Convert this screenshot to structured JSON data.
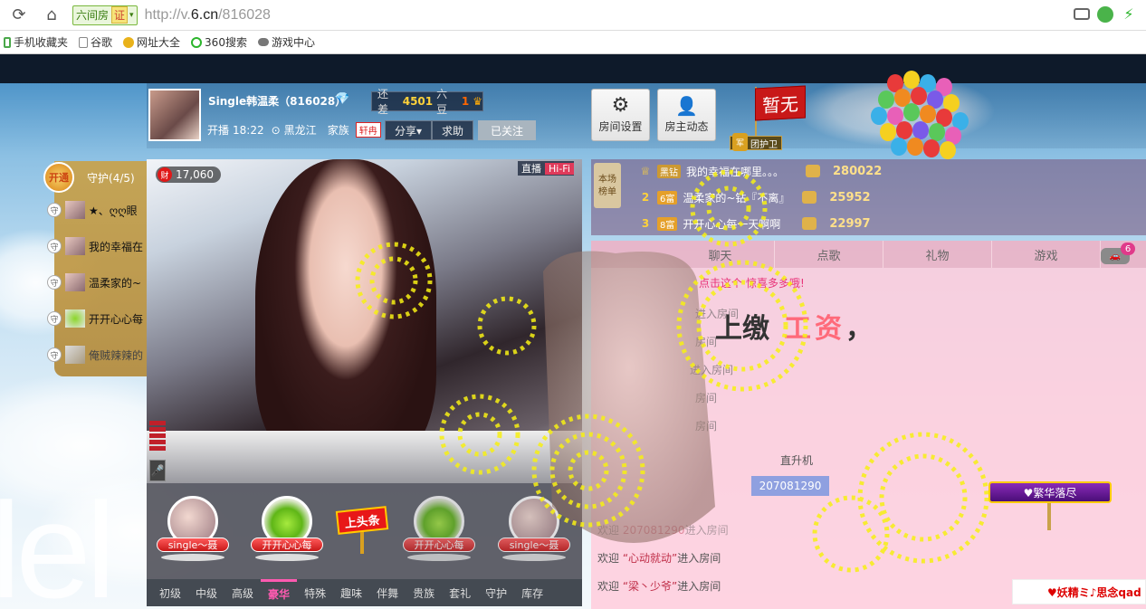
{
  "browser": {
    "site_badge": "六间房",
    "cert_badge": "证",
    "url_prefix": "http://v.",
    "url_domain": "6.cn",
    "url_path": "/816028"
  },
  "bookmarks": [
    {
      "label": "手机收藏夹",
      "icon": "phone-icon"
    },
    {
      "label": "谷歌",
      "icon": "page-icon"
    },
    {
      "label": "网址大全",
      "icon": "globe-icon"
    },
    {
      "label": "360搜索",
      "icon": "search-360-icon"
    },
    {
      "label": "游戏中心",
      "icon": "gamepad-icon"
    }
  ],
  "anchor": {
    "name": "Single韩温柔（816028）",
    "gap_label": "还差",
    "gap_amount": "4501",
    "gap_unit": "六豆",
    "level": "1",
    "start_label": "开播",
    "start_time": "18:22",
    "location": "黑龙江",
    "family_label": "家族",
    "family_tag": "轩冉"
  },
  "header_buttons": {
    "share": "分享▾",
    "help": "求助",
    "followed": "已关注",
    "room_settings": "房间设置",
    "host_feed": "房主动态",
    "badge_none": "暂无",
    "guard_tag": "团护卫",
    "guard_shield": "军"
  },
  "guard": {
    "open": "开通",
    "title_prefix": "守护(",
    "count": "4",
    "total": "5",
    "items": [
      {
        "tag": "守",
        "name": "★、ღღ眼"
      },
      {
        "tag": "守",
        "name": "我的幸福在"
      },
      {
        "tag": "守",
        "name": "温柔家的~"
      },
      {
        "tag": "守",
        "name": "开开心心每"
      },
      {
        "tag": "守",
        "name": "俺贼辣辣的"
      }
    ]
  },
  "video": {
    "viewer_coin": "财",
    "viewer_count": "17,060",
    "live": "直播",
    "hifi": "Hi-Fi",
    "mic": "🎤"
  },
  "gifts": {
    "headline": "上头条",
    "items": [
      "single～聂",
      "开开心心每",
      "开开心心每",
      "single～聂"
    ],
    "tabs": [
      "初级",
      "中级",
      "高级",
      "豪华",
      "特殊",
      "趣味",
      "伴舞",
      "贵族",
      "套礼",
      "守护",
      "库存"
    ],
    "active_tab": "豪华"
  },
  "ranking": {
    "badge_line1": "本场",
    "badge_line2": "榜单",
    "rows": [
      {
        "no": "1",
        "vip": "黑钻",
        "name": "我的幸福在哪里。。。",
        "amount": "280022"
      },
      {
        "no": "2",
        "vip": "6富",
        "name": "温柔家的~钻『不离』",
        "amount": "25952"
      },
      {
        "no": "3",
        "vip": "8富",
        "name": "开开心心每一天啊啊",
        "amount": "22997"
      }
    ]
  },
  "chat": {
    "tabs": [
      "聊天",
      "点歌",
      "礼物",
      "游戏"
    ],
    "car_count": "6",
    "hint_prefix": "点击这个",
    "hint_link": "惊喜多多哦!",
    "banner_a": "上缴",
    "banner_b": "工资",
    "banner_c": "，",
    "faded_lines": [
      "进入房间",
      "房间",
      "进入房间",
      "房间",
      "房间"
    ],
    "heli": "直升机",
    "uid": "207081290",
    "welcome_prefix": "欢迎",
    "welcome_suffix": "进入房间",
    "lines": [
      {
        "user": "207081290",
        "faded": true
      },
      {
        "user": "“心动就动”",
        "faded": false
      },
      {
        "user": "“梁丶少爷”",
        "faded": false
      }
    ],
    "fancy_name": "♥繁华落尽",
    "notice": "♥妖精ミ♪思念qad"
  }
}
